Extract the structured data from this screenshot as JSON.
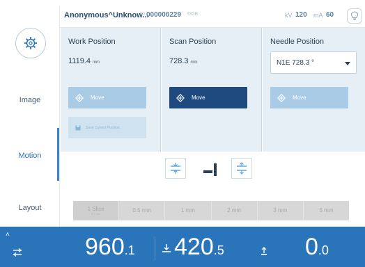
{
  "header": {
    "patient_name": "Anonymous^Unknow...",
    "id_label": "ID",
    "id_value": "000000229",
    "dob_label": "DOB",
    "kv_label": "kV",
    "kv_value": "120",
    "ma_label": "mA",
    "ma_value": "60"
  },
  "sidebar": {
    "items": [
      {
        "label": "Image"
      },
      {
        "label": "Motion"
      },
      {
        "label": "Layout"
      }
    ],
    "active": "Motion"
  },
  "panels": {
    "work": {
      "title": "Work Position",
      "value": "1119.4",
      "unit": "mm",
      "move_label": "Move",
      "save_label": "Save Current Position"
    },
    "scan": {
      "title": "Scan Position",
      "value": "728.3",
      "unit": "mm",
      "move_label": "Move"
    },
    "needle": {
      "title": "Needle Position",
      "selected": "N1E 728.3 °",
      "move_label": "Move"
    }
  },
  "slices": [
    {
      "label": "1 Slice",
      "sub": "3.3 mm"
    },
    {
      "label": "0.5 mm"
    },
    {
      "label": "1 mm"
    },
    {
      "label": "2 mm"
    },
    {
      "label": "3 mm"
    },
    {
      "label": "5 mm"
    }
  ],
  "status_bar": {
    "table_h_main": "960",
    "table_h_dec": ".1",
    "table_v_main": "420",
    "table_v_dec": ".5",
    "tilt_main": "0",
    "tilt_dec": ".0"
  },
  "colors": {
    "accent": "#2a74b9",
    "move_dark": "#1e4a80",
    "move_light": "#a9cbe6",
    "panel_bg": "#e6eff5"
  },
  "icons": [
    "gear-icon",
    "bulb-icon",
    "target-icon",
    "save-icon",
    "table-move-icon",
    "table-up-icon",
    "chevron-up-icon"
  ]
}
